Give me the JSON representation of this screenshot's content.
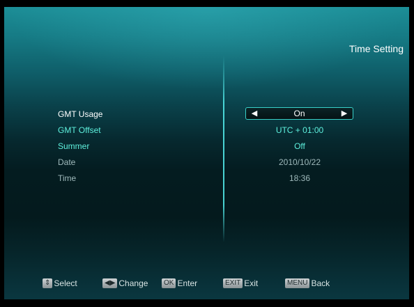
{
  "title": "Time Setting",
  "settings": [
    {
      "label": "GMT Usage",
      "value": "On"
    },
    {
      "label": "GMT Offset",
      "value": "UTC + 01:00"
    },
    {
      "label": "Summer",
      "value": "Off"
    },
    {
      "label": "Date",
      "value": "2010/10/22"
    },
    {
      "label": "Time",
      "value": "18:36"
    }
  ],
  "selector": {
    "left_arrow": "◀",
    "right_arrow": "▶"
  },
  "footer": {
    "select": {
      "key": "⇕",
      "label": "Select"
    },
    "change": {
      "key": "◀▶",
      "label": "Change"
    },
    "enter": {
      "key": "OK",
      "label": "Enter"
    },
    "exit": {
      "key": "EXIT",
      "label": "Exit"
    },
    "back": {
      "key": "MENU",
      "label": "Back"
    }
  },
  "colors": {
    "highlight_label": "#5ef0dd",
    "normal_label": "#ffffff",
    "disabled_label": "#9fb9bb",
    "accent_border": "#39d0c8"
  }
}
